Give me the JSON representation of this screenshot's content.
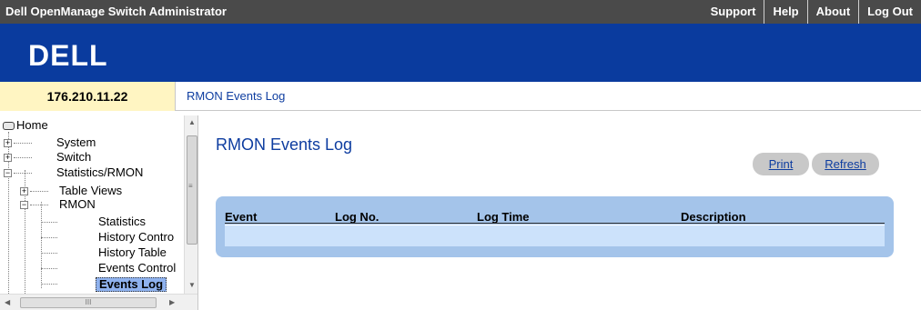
{
  "app": {
    "title": "Dell OpenManage Switch Administrator"
  },
  "topnav": {
    "items": [
      "Support",
      "Help",
      "About",
      "Log Out"
    ]
  },
  "brand": {
    "logo_text": "DELL",
    "band_color": "#0a3b9e"
  },
  "ip": {
    "address": "176.210.11.22"
  },
  "breadcrumb": {
    "text": "RMON Events Log"
  },
  "tree": {
    "home": "Home",
    "system": "System",
    "switch": "Switch",
    "statistics_rmon": "Statistics/RMON",
    "table_views": "Table Views",
    "rmon": "RMON",
    "statistics": "Statistics",
    "history_control": "History Contro",
    "history_table": "History Table",
    "events_control": "Events Control",
    "events_log": "Events Log"
  },
  "scrollbar": {
    "grip": "III",
    "grip_v": "≡"
  },
  "page": {
    "title": "RMON Events Log"
  },
  "buttons": {
    "print": "Print",
    "refresh": "Refresh"
  },
  "table": {
    "columns": [
      "Event",
      "Log No.",
      "Log Time",
      "Description"
    ],
    "rows": []
  },
  "colors": {
    "accent": "#0e3da0",
    "panel": "#a4c4ea",
    "row": "#cce2fb",
    "ip_bg": "#fff5c2",
    "selected": "#8fb2ee"
  }
}
